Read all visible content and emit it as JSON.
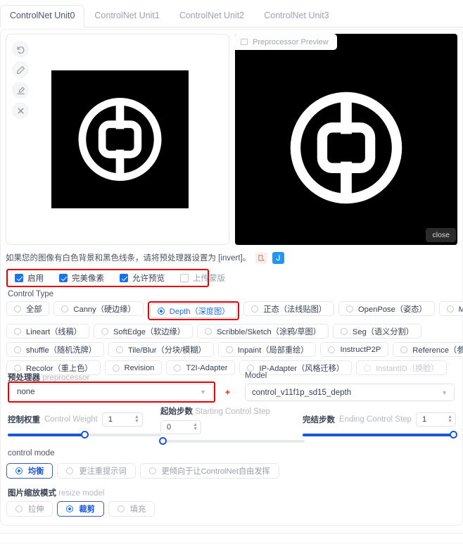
{
  "tabs": [
    {
      "label": "ControlNet Unit0",
      "active": true
    },
    {
      "label": "ControlNet Unit1",
      "active": false
    },
    {
      "label": "ControlNet Unit2",
      "active": false
    },
    {
      "label": "ControlNet Unit3",
      "active": false
    }
  ],
  "image_panel": {
    "tools": [
      "undo-icon",
      "edit-icon",
      "remove-background-icon",
      "clear-icon"
    ],
    "preview_label": "Preprocessor Preview",
    "close_label": "close"
  },
  "hint": {
    "text": "如果您的图像有白色背景和黑色线条，请将预处理器设置为 [invert]。",
    "icons": [
      "edit-note-icon",
      "j-app-icon"
    ]
  },
  "checkboxes": [
    {
      "label": "启用",
      "checked": true,
      "disabled": false
    },
    {
      "label": "完美像素",
      "checked": true,
      "disabled": false
    },
    {
      "label": "允许预览",
      "checked": true,
      "disabled": false
    },
    {
      "label": "上传蒙版",
      "checked": false,
      "disabled": true
    }
  ],
  "control_type": {
    "title": "Control Type",
    "rows": [
      [
        {
          "label": "全部",
          "selected": false,
          "disabled": false,
          "highlight": false
        },
        {
          "label": "Canny（硬边缘）",
          "selected": false,
          "disabled": false,
          "highlight": false
        },
        {
          "label": "Depth（深度图）",
          "selected": true,
          "disabled": false,
          "highlight": true
        },
        {
          "label": "正态（法线贴图）",
          "selected": false,
          "disabled": false,
          "highlight": false
        },
        {
          "label": "OpenPose（姿态）",
          "selected": false,
          "disabled": false,
          "highlight": false
        },
        {
          "label": "MLSD（直线）",
          "selected": false,
          "disabled": false,
          "highlight": false
        }
      ],
      [
        {
          "label": "Lineart（线稿）",
          "selected": false,
          "disabled": false,
          "highlight": false
        },
        {
          "label": "SoftEdge（软边缘）",
          "selected": false,
          "disabled": false,
          "highlight": false
        },
        {
          "label": "Scribble/Sketch（涂鸦/草图）",
          "selected": false,
          "disabled": false,
          "highlight": false
        },
        {
          "label": "Seg（语义分割）",
          "selected": false,
          "disabled": false,
          "highlight": false
        }
      ],
      [
        {
          "label": "shuffle（随机洗牌）",
          "selected": false,
          "disabled": false,
          "highlight": false
        },
        {
          "label": "Tile/Blur（分块/模糊）",
          "selected": false,
          "disabled": false,
          "highlight": false
        },
        {
          "label": "Inpaint（局部重绘）",
          "selected": false,
          "disabled": false,
          "highlight": false
        },
        {
          "label": "InstructP2P",
          "selected": false,
          "disabled": false,
          "highlight": false
        },
        {
          "label": "Reference（参考）",
          "selected": false,
          "disabled": false,
          "highlight": false
        }
      ],
      [
        {
          "label": "Recolor（重上色）",
          "selected": false,
          "disabled": false,
          "highlight": false
        },
        {
          "label": "Revision",
          "selected": false,
          "disabled": false,
          "highlight": false
        },
        {
          "label": "T2I-Adapter",
          "selected": false,
          "disabled": false,
          "highlight": false
        },
        {
          "label": "IP-Adapter（风格迁移）",
          "selected": false,
          "disabled": false,
          "highlight": false
        },
        {
          "label": "InstantID（换脸）",
          "selected": false,
          "disabled": true,
          "highlight": false
        }
      ]
    ]
  },
  "preprocessor": {
    "label_cn": "预处理器",
    "label_en": "preprocessor",
    "value": "none",
    "star_icon": "pin-icon"
  },
  "model": {
    "label": "Model",
    "value": "control_v11f1p_sd15_depth"
  },
  "sliders": {
    "control_weight": {
      "label_cn": "控制权重",
      "label_en": "Control Weight",
      "value": "1",
      "percent": 50
    },
    "starting_step": {
      "label_cn": "起始步数",
      "label_en": "Starting Control Step",
      "value": "0",
      "percent": 0
    },
    "ending_step": {
      "label_cn": "完结步数",
      "label_en": "Ending Control Step",
      "value": "1",
      "percent": 100
    }
  },
  "control_mode": {
    "title": "control mode",
    "options": [
      {
        "label": "均衡",
        "selected": true
      },
      {
        "label": "更注重提示词",
        "selected": false
      },
      {
        "label": "更倾向于让ControlNet自由发挥",
        "selected": false
      }
    ]
  },
  "resize_mode": {
    "label_cn": "图片缩放模式",
    "label_en": "resize model",
    "options": [
      {
        "label": "拉伸",
        "selected": false
      },
      {
        "label": "裁剪",
        "selected": true
      },
      {
        "label": "填充",
        "selected": false
      }
    ]
  },
  "colors": {
    "accent_blue": "#1a73e8",
    "slider_blue": "#1a56db",
    "highlight_red": "#e60000",
    "border_grey": "#e6e8eb",
    "disabled_grey": "#c3c7cc"
  }
}
